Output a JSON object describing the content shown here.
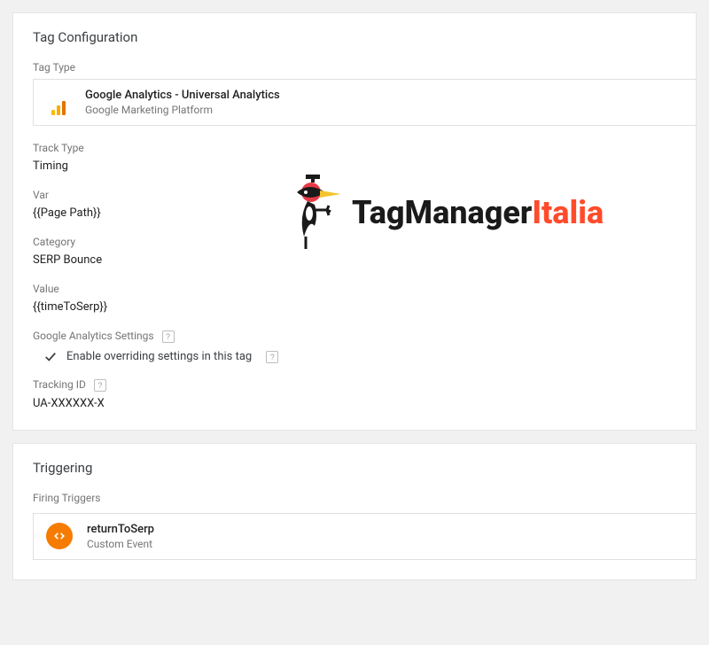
{
  "tagConfig": {
    "title": "Tag Configuration",
    "tagTypeLabel": "Tag Type",
    "tagTypeTitle": "Google Analytics - Universal Analytics",
    "tagTypeSub": "Google Marketing Platform",
    "trackTypeLabel": "Track Type",
    "trackTypeValue": "Timing",
    "varLabel": "Var",
    "varValue": "{{Page Path}}",
    "categoryLabel": "Category",
    "categoryValue": "SERP Bounce",
    "valueLabel": "Value",
    "valueValue": "{{timeToSerp}}",
    "gaSettingsLabel": "Google Analytics Settings",
    "overrideLabel": "Enable overriding settings in this tag",
    "trackingIdLabel": "Tracking ID",
    "trackingIdValue": "UA-XXXXXX-X"
  },
  "triggering": {
    "title": "Triggering",
    "firingLabel": "Firing Triggers",
    "triggerName": "returnToSerp",
    "triggerType": "Custom Event"
  },
  "watermark": {
    "text1": "TagManager",
    "text2": "Italia"
  }
}
